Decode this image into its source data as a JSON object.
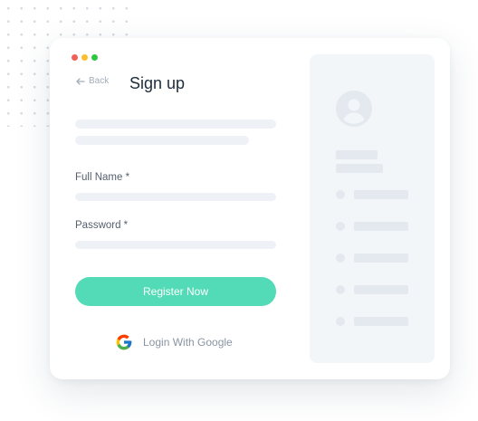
{
  "window": {
    "traffic_lights": {
      "close_color": "#f25f58",
      "minimize_color": "#fbbe2e",
      "maximize_color": "#2dc840"
    }
  },
  "header": {
    "back_label": "Back",
    "title": "Sign up"
  },
  "form": {
    "full_name_label": "Full Name *",
    "password_label": "Password *",
    "register_label": "Register Now",
    "google_label": "Login With Google"
  },
  "colors": {
    "accent": "#52dbb6",
    "title": "#1d2b3a",
    "muted": "#8a95a3",
    "skeleton": "#eef2f6",
    "panel": "#f3f6f9"
  },
  "icons": {
    "back": "arrow-left-icon",
    "google": "google-logo-icon",
    "avatar": "user-avatar-icon"
  }
}
